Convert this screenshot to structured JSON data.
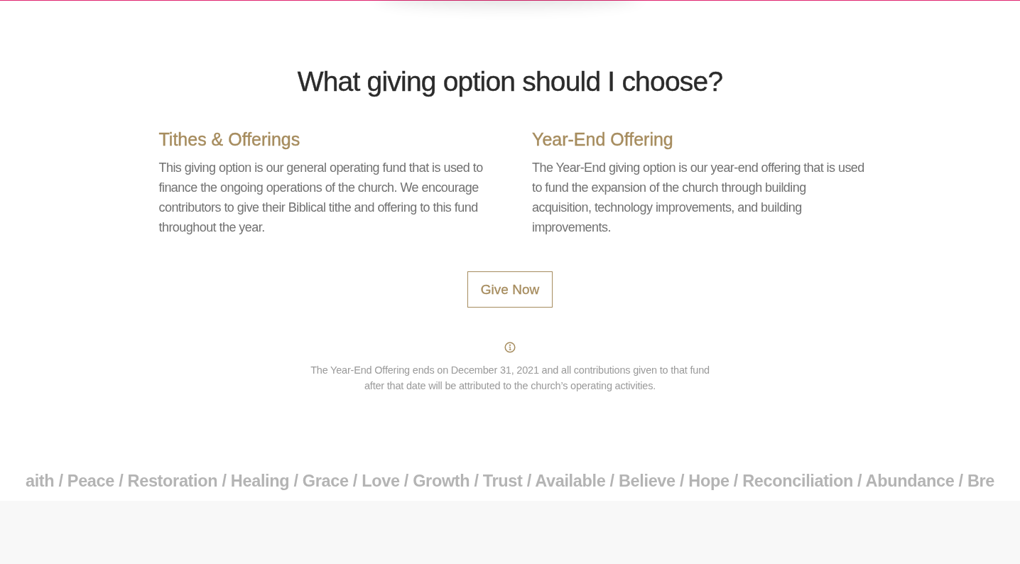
{
  "heading": "What giving option should I choose?",
  "options": [
    {
      "title": "Tithes & Offerings",
      "text": "This giving option is our general operating fund that is used to finance the ongoing operations of the church. We encourage contributors to give their Biblical tithe and offering to this fund throughout the year."
    },
    {
      "title": "Year-End Offering",
      "text": "The Year-End giving option is our year-end offering that is used to fund the expansion of the church through building acquisition, technology improvements, and building improvements."
    }
  ],
  "button": "Give Now",
  "note": "The Year-End Offering ends on December 31, 2021 and all contributions given to that fund after that date will be attributed to the church’s operating activities.",
  "ticker": "aith / Peace / Restoration / Healing / Grace / Love / Growth / Trust / Available / Believe / Hope / Reconciliation / Abundance / Bre"
}
